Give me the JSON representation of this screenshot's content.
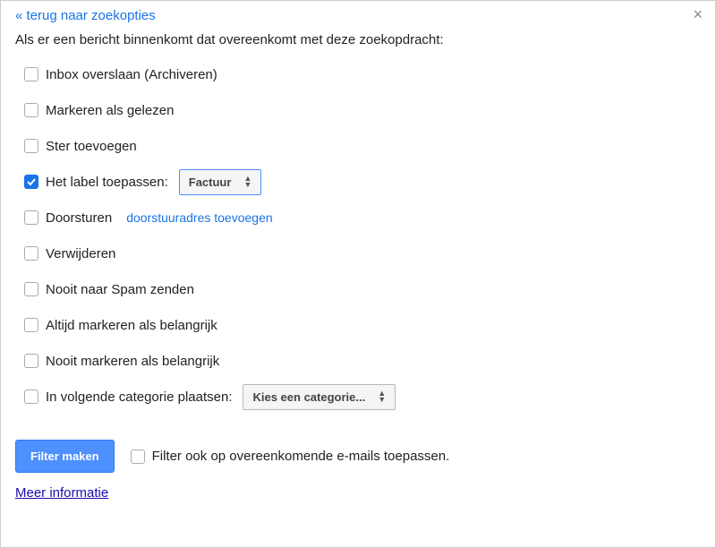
{
  "header": {
    "back_link": "« terug naar zoekopties",
    "close_glyph": "×"
  },
  "intro": "Als er een bericht binnenkomt dat overeenkomt met deze zoekopdracht:",
  "options": [
    {
      "label": "Inbox overslaan (Archiveren)",
      "checked": false
    },
    {
      "label": "Markeren als gelezen",
      "checked": false
    },
    {
      "label": "Ster toevoegen",
      "checked": false
    },
    {
      "label": "Het label toepassen:",
      "checked": true,
      "select_value": "Factuur"
    },
    {
      "label": "Doorsturen",
      "checked": false,
      "extra_link": "doorstuuradres toevoegen"
    },
    {
      "label": "Verwijderen",
      "checked": false
    },
    {
      "label": "Nooit naar Spam zenden",
      "checked": false
    },
    {
      "label": "Altijd markeren als belangrijk",
      "checked": false
    },
    {
      "label": "Nooit markeren als belangrijk",
      "checked": false
    },
    {
      "label": "In volgende categorie plaatsen:",
      "checked": false,
      "select_value": "Kies een categorie..."
    }
  ],
  "footer": {
    "button_label": "Filter maken",
    "also_apply_label": "Filter ook op overeenkomende e-mails toepassen."
  },
  "more_info": "Meer informatie"
}
